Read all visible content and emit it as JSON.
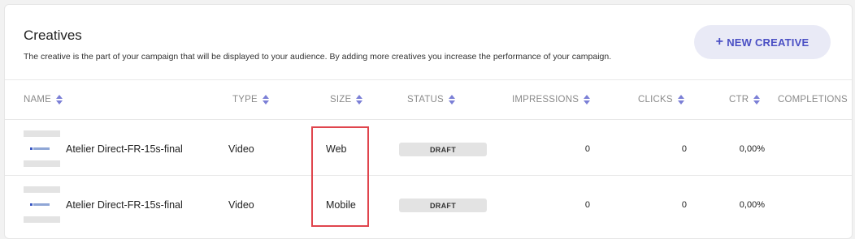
{
  "header": {
    "title": "Creatives",
    "subtitle": "The creative is the part of your campaign that will be displayed to your audience. By adding more creatives you increase the performance of your campaign.",
    "new_button_label": "NEW CREATIVE",
    "new_button_icon": "plus-icon"
  },
  "table": {
    "columns": [
      "NAME",
      "TYPE",
      "SIZE",
      "STATUS",
      "IMPRESSIONS",
      "CLICKS",
      "CTR",
      "COMPLETIONS"
    ],
    "rows": [
      {
        "name": "Atelier Direct-FR-15s-final",
        "type": "Video",
        "size": "Web",
        "status": "DRAFT",
        "impressions": "0",
        "clicks": "0",
        "ctr": "0,00%"
      },
      {
        "name": "Atelier Direct-FR-15s-final",
        "type": "Video",
        "size": "Mobile",
        "status": "DRAFT",
        "impressions": "0",
        "clicks": "0",
        "ctr": "0,00%"
      }
    ]
  },
  "colors": {
    "accent": "#4a4fc4",
    "sort_arrow": "#7b7fd6",
    "button_bg": "#e9eaf6",
    "highlight": "#e0454d",
    "badge_bg": "#e3e3e3"
  }
}
